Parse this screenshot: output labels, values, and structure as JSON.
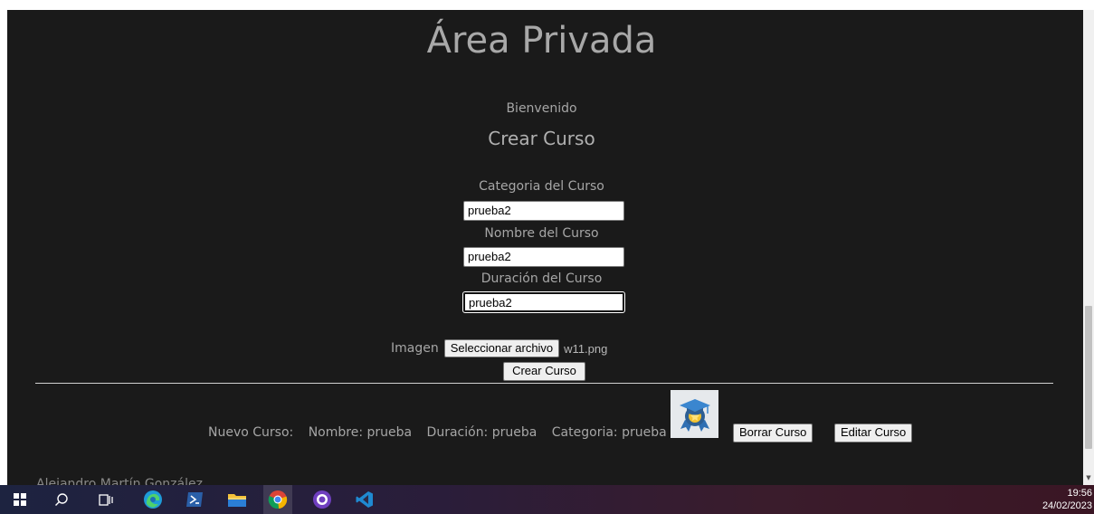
{
  "page": {
    "title": "Área Privada",
    "welcome": "Bienvenido",
    "form_title": "Crear Curso"
  },
  "form": {
    "category_label": "Categoria del Curso",
    "category_value": "prueba2",
    "name_label": "Nombre del Curso",
    "name_value": "prueba2",
    "duration_label": "Duración del Curso",
    "duration_value": "prueba2",
    "image_label": "Imagen",
    "file_button": "Seleccionar archivo",
    "file_name": "w11.png",
    "submit": "Crear Curso"
  },
  "course": {
    "prefix": "Nuevo Curso:",
    "name": "Nombre: prueba",
    "duration": "Duración: prueba",
    "category": "Categoria: prueba",
    "delete": "Borrar Curso",
    "edit": "Editar Curso"
  },
  "footer": {
    "author": "Alejandro Martín González"
  },
  "taskbar": {
    "icons": [
      "windows-start-icon",
      "search-icon",
      "task-view-icon",
      "edge-icon",
      "powershell-icon",
      "file-explorer-icon",
      "chrome-icon",
      "github-desktop-icon",
      "vscode-icon"
    ],
    "time": "19:56",
    "date": "24/02/2023"
  },
  "colors": {
    "background": "#1a1a1a",
    "text": "#a6a6a6"
  }
}
